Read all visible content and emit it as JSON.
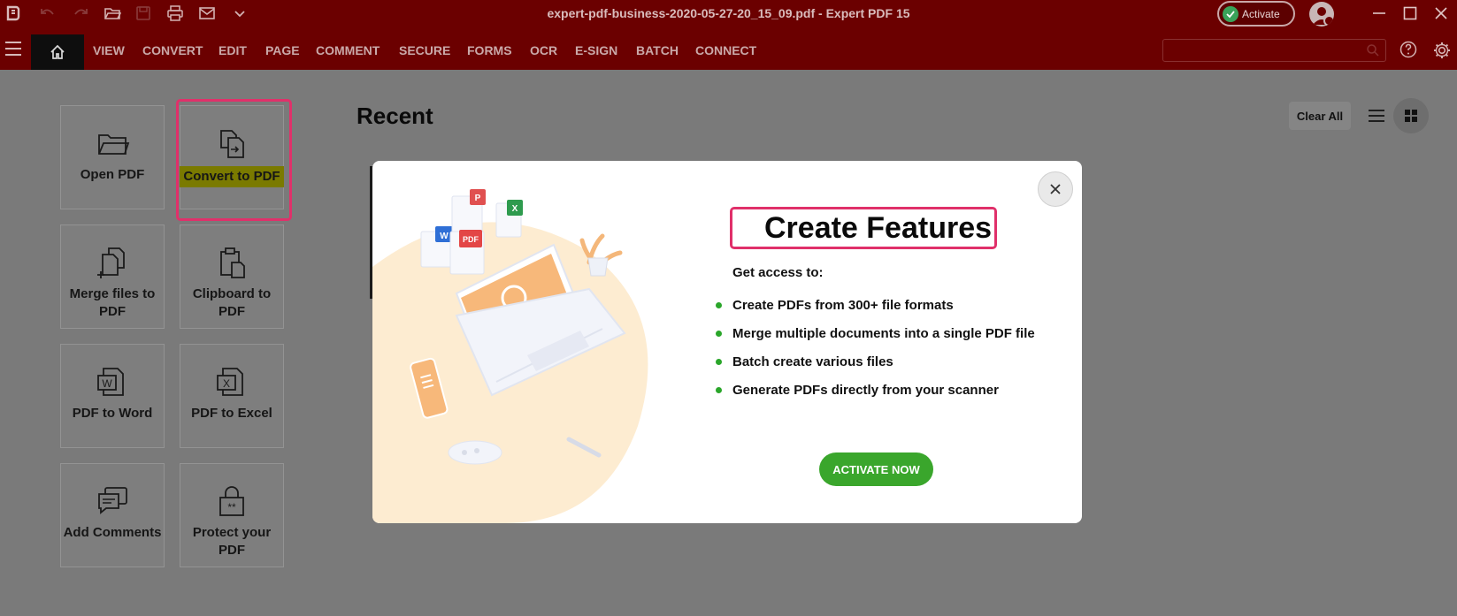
{
  "titlebar": {
    "title": "expert-pdf-business-2020-05-27-20_15_09.pdf   -   Expert PDF 15",
    "activate_label": "Activate",
    "icons": [
      "app-logo-icon",
      "undo-icon",
      "redo-icon",
      "open-folder-icon",
      "save-icon",
      "print-icon",
      "mail-icon",
      "chevron-down-icon"
    ]
  },
  "menubar": {
    "items": [
      "VIEW",
      "CONVERT",
      "EDIT",
      "PAGE",
      "COMMENT",
      "SECURE",
      "FORMS",
      "OCR",
      "E-SIGN",
      "BATCH",
      "CONNECT"
    ],
    "search_placeholder": ""
  },
  "tiles": [
    {
      "label": "Open PDF",
      "icon": "folder-icon"
    },
    {
      "label": "Convert to PDF",
      "icon": "convert-icon"
    },
    {
      "label": "Merge files to PDF",
      "icon": "merge-files-icon"
    },
    {
      "label": "Clipboard to PDF",
      "icon": "clipboard-icon"
    },
    {
      "label": "PDF to Word",
      "icon": "word-icon"
    },
    {
      "label": "PDF to Excel",
      "icon": "excel-icon"
    },
    {
      "label": "Add Comments",
      "icon": "comments-icon"
    },
    {
      "label": "Protect your PDF",
      "icon": "lock-icon"
    }
  ],
  "recent": {
    "title": "Recent",
    "clear_all": "Clear All"
  },
  "modal": {
    "title": "Create Features",
    "subtitle": "Get access to:",
    "features": [
      "Create PDFs from 300+ file formats",
      "Merge multiple documents into a single PDF file",
      "Batch create various files",
      "Generate PDFs directly from your scanner"
    ],
    "cta": "ACTIVATE NOW",
    "illustration_badges": [
      "P",
      "X",
      "W",
      "PDF"
    ]
  },
  "colors": {
    "brand_red": "#b00000",
    "highlight_pink": "#e0306a",
    "accent_green": "#3aa62c"
  }
}
